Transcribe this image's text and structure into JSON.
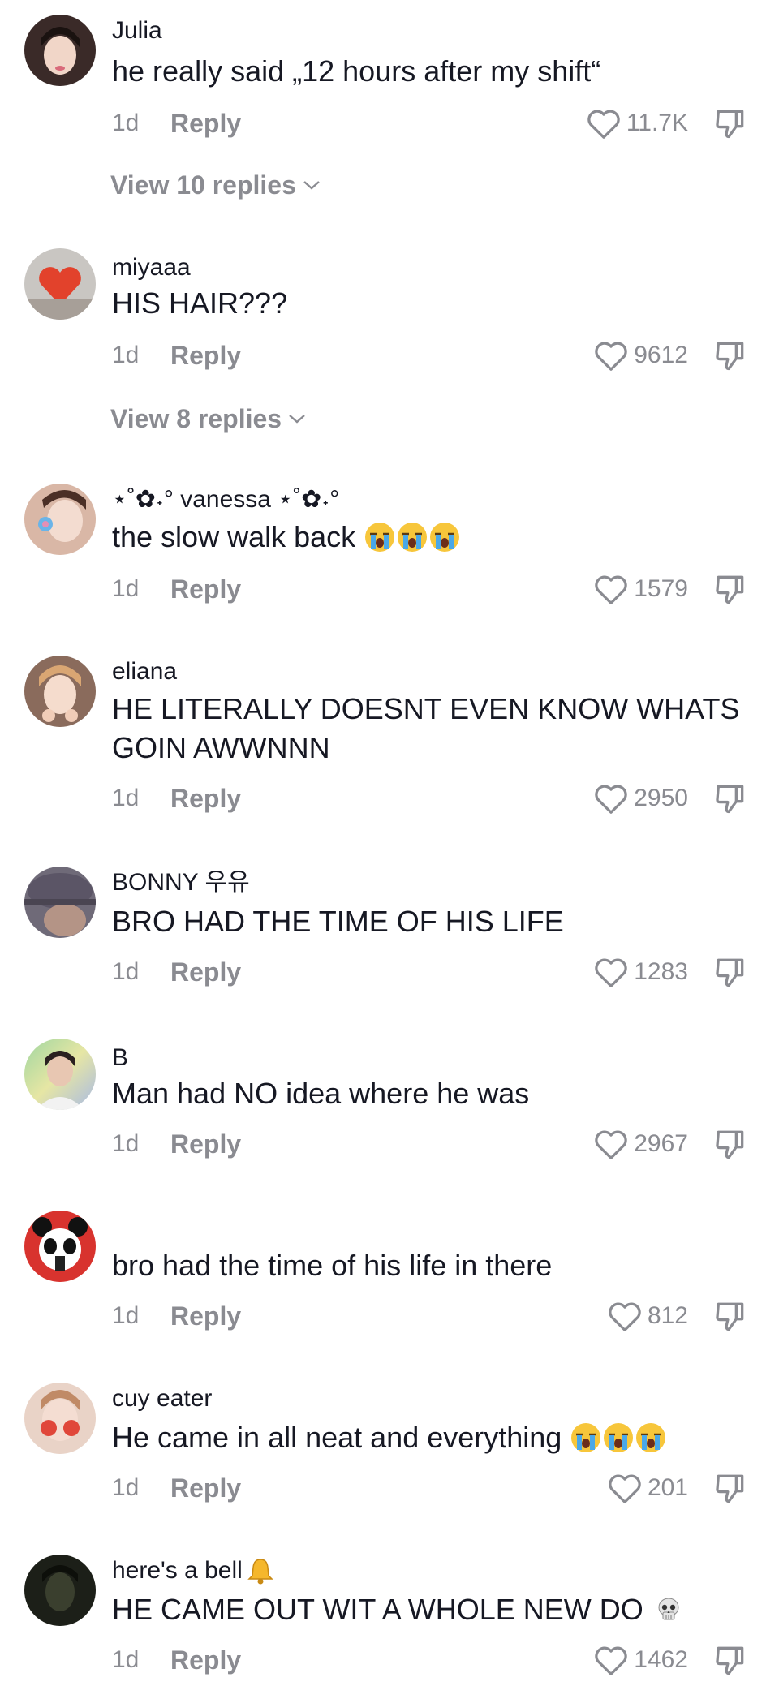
{
  "comments": [
    {
      "username": "Julia",
      "text": "he really said „12 hours after my shift“",
      "time": "1d",
      "reply_label": "Reply",
      "likes": "11.7K",
      "view_replies": "View 10 replies",
      "avatar_color": "#3a2a28"
    },
    {
      "username": "miyaaa",
      "text": "HIS HAIR???",
      "time": "1d",
      "reply_label": "Reply",
      "likes": "9612",
      "view_replies": "View 8 replies",
      "avatar_color": "#c9c6c2"
    },
    {
      "username": "⋆˚✿˖° vanessa ⋆˚✿˖°",
      "text": "the slow walk back",
      "emoji": "loudly-crying-face x3",
      "time": "1d",
      "reply_label": "Reply",
      "likes": "1579",
      "avatar_color": "#d9b7a6"
    },
    {
      "username": "eliana",
      "text": "HE LITERALLY DOESNT EVEN KNOW WHATS GOIN AWWNNN",
      "time": "1d",
      "reply_label": "Reply",
      "likes": "2950",
      "avatar_color": "#8a6b5c"
    },
    {
      "username": "BONNY 우유",
      "text": "BRO HAD THE TIME OF HIS LIFE",
      "time": "1d",
      "reply_label": "Reply",
      "likes": "1283",
      "avatar_color": "#6f6a78"
    },
    {
      "username": "B",
      "text": "Man had NO idea where he was",
      "time": "1d",
      "reply_label": "Reply",
      "likes": "2967",
      "avatar_color": "#5b6e6a"
    },
    {
      "username": "",
      "text": "bro had the time of his life in there",
      "time": "1d",
      "reply_label": "Reply",
      "likes": "812",
      "avatar_color": "#d8332e"
    },
    {
      "username": "cuy eater",
      "text": "He came in all neat and everything",
      "emoji": "loudly-crying-face x3",
      "time": "1d",
      "reply_label": "Reply",
      "likes": "201",
      "avatar_color": "#e9d3c7"
    },
    {
      "username": "here's a bell",
      "username_emoji": "bell-icon",
      "text": "HE CAME OUT WIT A WHOLE NEW DO",
      "emoji": "skull",
      "time": "1d",
      "reply_label": "Reply",
      "likes": "1462",
      "avatar_color": "#1c1f18"
    }
  ]
}
